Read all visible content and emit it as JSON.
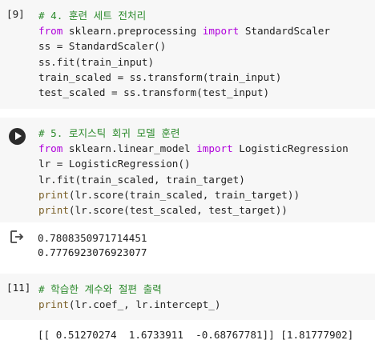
{
  "cells": [
    {
      "exec_label": "[9]",
      "lines": [
        [
          {
            "t": "# 4. 훈련 세트 전처리",
            "c": "cm"
          }
        ],
        [
          {
            "t": "from",
            "c": "kw"
          },
          {
            "t": " sklearn.preprocessing ",
            "c": "txt"
          },
          {
            "t": "import",
            "c": "kw"
          },
          {
            "t": " StandardScaler",
            "c": "txt"
          }
        ],
        [
          {
            "t": "ss = StandardScaler()",
            "c": "txt"
          }
        ],
        [
          {
            "t": "ss.fit(train_input)",
            "c": "txt"
          }
        ],
        [
          {
            "t": "train_scaled = ss.transform(train_input)",
            "c": "txt"
          }
        ],
        [
          {
            "t": "test_scaled = ss.transform(test_input)",
            "c": "txt"
          }
        ]
      ]
    },
    {
      "run_icon": "play-circle-icon",
      "lines": [
        [
          {
            "t": "# 5. 로지스틱 회귀 모델 훈련",
            "c": "cm"
          }
        ],
        [
          {
            "t": "from",
            "c": "kw"
          },
          {
            "t": " sklearn.linear_model ",
            "c": "txt"
          },
          {
            "t": "import",
            "c": "kw"
          },
          {
            "t": " LogisticRegression",
            "c": "txt"
          }
        ],
        [
          {
            "t": "lr = LogisticRegression()",
            "c": "txt"
          }
        ],
        [
          {
            "t": "lr.fit(train_scaled, train_target)",
            "c": "txt"
          }
        ],
        [
          {
            "t": "print",
            "c": "fn"
          },
          {
            "t": "(lr.score(train_scaled, train_target))",
            "c": "txt"
          }
        ],
        [
          {
            "t": "print",
            "c": "fn"
          },
          {
            "t": "(lr.score(test_scaled, test_target))",
            "c": "txt"
          }
        ]
      ],
      "output_icon": "output-arrow-icon",
      "output": [
        "0.7808350971714451",
        "0.7776923076923077"
      ]
    },
    {
      "exec_label": "[11]",
      "lines": [
        [
          {
            "t": "# 학습한 계수와 절편 출력",
            "c": "cm"
          }
        ],
        [
          {
            "t": "print",
            "c": "fn"
          },
          {
            "t": "(lr.coef_, lr.intercept_)",
            "c": "txt"
          }
        ]
      ],
      "output": [
        "[[ 0.51270274  1.6733911  -0.68767781]] [1.81777902]"
      ]
    }
  ]
}
